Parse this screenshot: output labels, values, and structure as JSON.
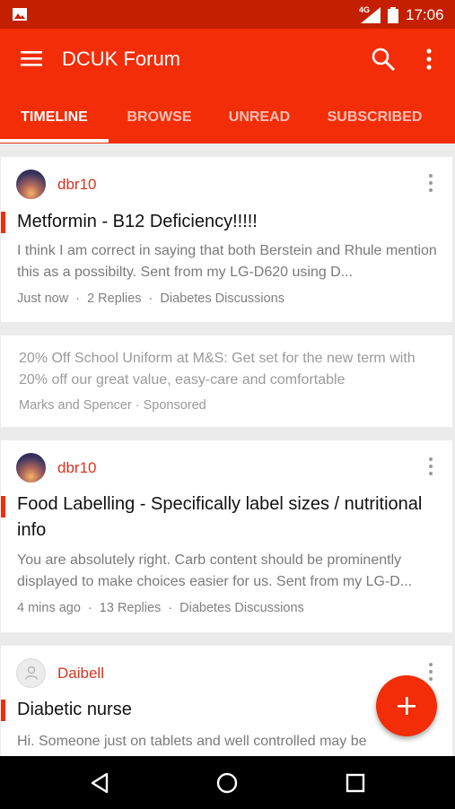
{
  "status": {
    "network": "4G",
    "time": "17:06"
  },
  "appbar": {
    "title": "DCUK Forum"
  },
  "tabs": [
    "TIMELINE",
    "BROWSE",
    "UNREAD",
    "SUBSCRIBED"
  ],
  "posts": [
    {
      "username": "dbr10",
      "title": "Metformin - B12 Deficiency!!!!!",
      "excerpt": "I think I am correct in saying that both Berstein and Rhule mention this as a possibilty. Sent from my LG-D620 using D...",
      "time": "Just now",
      "replies": "2 Replies",
      "forum": "Diabetes Discussions"
    },
    {
      "username": "dbr10",
      "title": "Food Labelling - Specifically label sizes / nutritional info",
      "excerpt": "You are absolutely right. Carb content should be prominently displayed to make choices easier for us. Sent from my LG-D...",
      "time": "4 mins ago",
      "replies": "13 Replies",
      "forum": "Diabetes Discussions"
    },
    {
      "username": "Daibell",
      "title": "Diabetic nurse",
      "excerpt": "Hi. Someone just on tablets and well controlled may be"
    }
  ],
  "ad": {
    "text": "20% Off School Uniform at M&S: Get set for the new term with 20% off our great value, easy-care and comfortable",
    "sponsor": "Marks and Spencer · Sponsored"
  },
  "colors": {
    "primary": "#f22d08",
    "status_bar": "#c41f00",
    "username": "#d9341c"
  },
  "icons": {
    "menu": "hamburger-icon",
    "search": "search-icon",
    "more": "more-vert-icon",
    "fab": "plus-icon",
    "nav_back": "back-triangle-icon",
    "nav_home": "home-circle-icon",
    "nav_recent": "recent-square-icon"
  }
}
